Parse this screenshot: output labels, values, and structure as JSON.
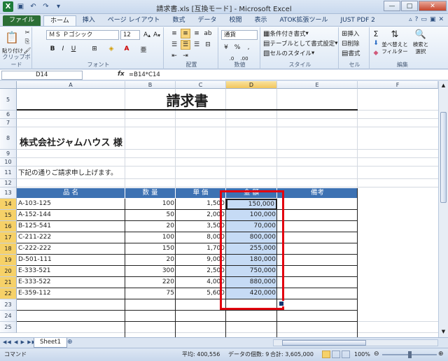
{
  "window": {
    "title": "請求書.xls  [互換モード]  -  Microsoft Excel"
  },
  "ribbon_tabs": [
    "ファイル",
    "ホーム",
    "挿入",
    "ページ レイアウト",
    "数式",
    "データ",
    "校閲",
    "表示",
    "ATOK拡張ツール",
    "JUST PDF 2"
  ],
  "ribbon": {
    "clipboard": {
      "paste": "貼り付け",
      "label": "クリップボード"
    },
    "font": {
      "name": "ＭＳ Ｐゴシック",
      "size": "12",
      "label": "フォント"
    },
    "alignment": {
      "label": "配置"
    },
    "number": {
      "format": "通貨",
      "label": "数値"
    },
    "styles": {
      "conditional": "条件付き書式",
      "table": "テーブルとして書式設定",
      "cell": "セルのスタイル",
      "label": "スタイル"
    },
    "cells": {
      "insert": "挿入",
      "delete": "削除",
      "format": "書式",
      "label": "セル"
    },
    "editing": {
      "sort": "並べ替えと",
      "sort2": "フィルター",
      "find": "検索と",
      "find2": "選択",
      "label": "編集"
    }
  },
  "formula_bar": {
    "name_box": "D14",
    "formula": "=B14*C14"
  },
  "columns": [
    "A",
    "B",
    "C",
    "D",
    "E",
    "F"
  ],
  "rows": [
    "5",
    "6",
    "7",
    "8",
    "9",
    "10",
    "11",
    "12",
    "13",
    "14",
    "15",
    "16",
    "17",
    "18",
    "19",
    "20",
    "21",
    "22",
    "23",
    "24",
    "25"
  ],
  "sheet": {
    "title": "請求書",
    "recipient": "株式会社ジャムハウス  様",
    "note": "下記の通りご請求申し上げます。",
    "headers": [
      "品 名",
      "数 量",
      "単 価",
      "金 額",
      "備考"
    ],
    "items": [
      {
        "name": "A-103-125",
        "qty": "100",
        "price": "1,500",
        "amount": "150,000"
      },
      {
        "name": "A-152-144",
        "qty": "50",
        "price": "2,000",
        "amount": "100,000"
      },
      {
        "name": "B-125-541",
        "qty": "20",
        "price": "3,500",
        "amount": "70,000"
      },
      {
        "name": "C-211-222",
        "qty": "100",
        "price": "8,000",
        "amount": "800,000"
      },
      {
        "name": "C-222-222",
        "qty": "150",
        "price": "1,700",
        "amount": "255,000"
      },
      {
        "name": "D-501-111",
        "qty": "20",
        "price": "9,000",
        "amount": "180,000"
      },
      {
        "name": "E-333-521",
        "qty": "300",
        "price": "2,500",
        "amount": "750,000"
      },
      {
        "name": "E-333-522",
        "qty": "220",
        "price": "4,000",
        "amount": "880,000"
      },
      {
        "name": "E-359-112",
        "qty": "75",
        "price": "5,600",
        "amount": "420,000"
      }
    ]
  },
  "sheet_tab": "Sheet1",
  "status": {
    "mode": "コマンド",
    "average": "平均: 400,556",
    "count": "データの個数: 9",
    "sum": "合計: 3,605,000",
    "zoom": "100%"
  },
  "colors": {
    "header_fill": "#3d72b3",
    "selection": "#c6dbf5",
    "highlight_box": "#e2000f"
  }
}
